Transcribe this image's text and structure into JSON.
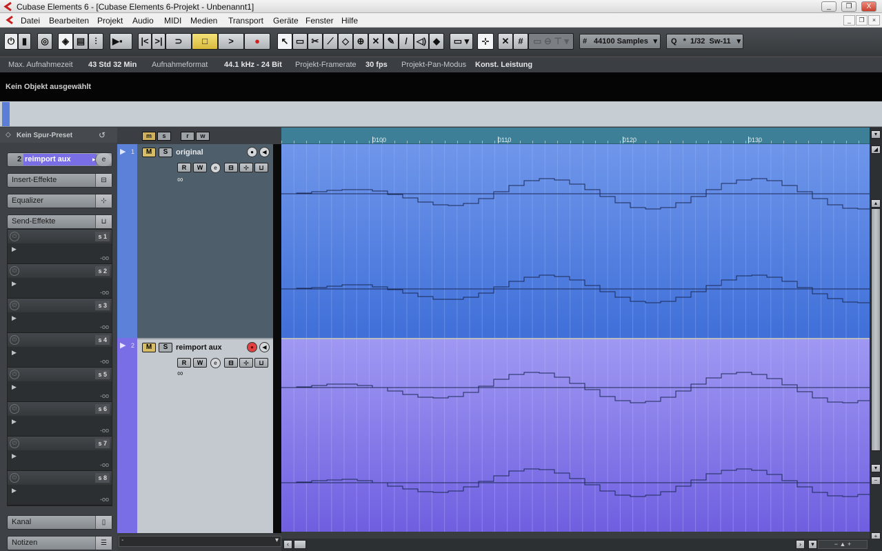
{
  "app": {
    "title": "Cubase Elements 6 - [Cubase Elements 6-Projekt - Unbenannt1]",
    "window_buttons": [
      "_",
      "❐",
      "X"
    ],
    "mdi_buttons": [
      "_",
      "❐",
      "×"
    ]
  },
  "menu": [
    "Datei",
    "Bearbeiten",
    "Projekt",
    "Audio",
    "MIDI",
    "Medien",
    "Transport",
    "Geräte",
    "Fenster",
    "Hilfe"
  ],
  "toolbar": {
    "grid_type": "44100 Samples",
    "quantize": "1/32  Sw-11",
    "quantize_prefix": "*",
    "q_label": "Q"
  },
  "infobar": {
    "max_rec_label": "Max. Aufnahmezeit",
    "max_rec_value": "43 Std 32 Min",
    "format_label": "Aufnahmeformat",
    "format_value": "44.1 kHz - 24 Bit",
    "framerate_label": "Projekt-Framerate",
    "framerate_value": "30 fps",
    "panmode_label": "Projekt-Pan-Modus",
    "panmode_value": "Konst. Leistung"
  },
  "infoline": {
    "text": "Kein Objekt ausgewählt"
  },
  "inspector": {
    "preset": "Kein Spur-Preset",
    "track_number": "2",
    "track_name": "reimport aux",
    "sections": {
      "insert": "Insert-Effekte",
      "eq": "Equalizer",
      "send": "Send-Effekte",
      "channel": "Kanal",
      "notes": "Notizen"
    },
    "send_slots": [
      {
        "label": "s 1",
        "db": "-oo"
      },
      {
        "label": "s 2",
        "db": "-oo"
      },
      {
        "label": "s 3",
        "db": "-oo"
      },
      {
        "label": "s 4",
        "db": "-oo"
      },
      {
        "label": "s 5",
        "db": "-oo"
      },
      {
        "label": "s 6",
        "db": "-oo"
      },
      {
        "label": "s 7",
        "db": "-oo"
      },
      {
        "label": "s 8",
        "db": "-oo"
      }
    ]
  },
  "tracklist_header": [
    "m",
    "s",
    "r",
    "w"
  ],
  "tracks": [
    {
      "number": "1",
      "name": "original",
      "mute": "M",
      "solo": "S",
      "read": "R",
      "write": "W",
      "link": "∞",
      "record_armed": false,
      "color": "#5b82d8"
    },
    {
      "number": "2",
      "name": "reimport aux",
      "mute": "M",
      "solo": "S",
      "read": "R",
      "write": "W",
      "link": "∞",
      "record_armed": true,
      "color": "#7a6ee6"
    }
  ],
  "ruler": {
    "labels": [
      "0100",
      "0110",
      "0120",
      "0130"
    ]
  },
  "bottom_left_field": "-"
}
